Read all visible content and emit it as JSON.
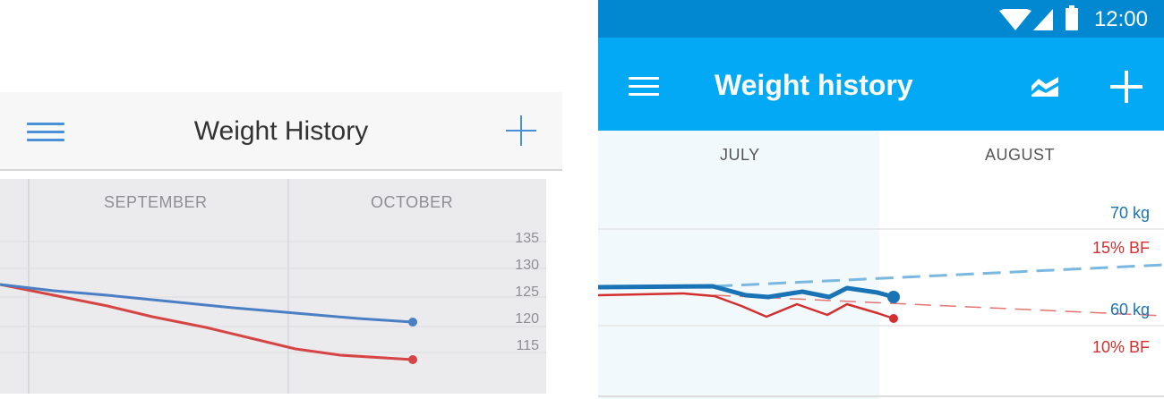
{
  "ios": {
    "title": "Weight History",
    "months": [
      "SEPTEMBER",
      "OCTOBER"
    ],
    "y_ticks": [
      "135",
      "130",
      "125",
      "120",
      "115"
    ],
    "colors": {
      "accent": "#4a90d9",
      "weight_line": "#4a7fc4",
      "bodyfat_line": "#d64545"
    }
  },
  "android": {
    "status_time": "12:00",
    "title": "Weight history",
    "months": [
      "JULY",
      "AUGUST"
    ],
    "labels": {
      "weight_high": "70 kg",
      "bf_high": "15% BF",
      "weight_low": "60 kg",
      "bf_low": "10% BF"
    },
    "colors": {
      "appbar": "#03a9f4",
      "statusbar": "#0288d1",
      "weight_line": "#1a73b5",
      "bodyfat_line": "#d32f2f"
    }
  },
  "icons": [
    "menu-icon",
    "add-icon",
    "trend-chart-icon",
    "wifi-icon",
    "signal-icon",
    "battery-icon"
  ]
}
